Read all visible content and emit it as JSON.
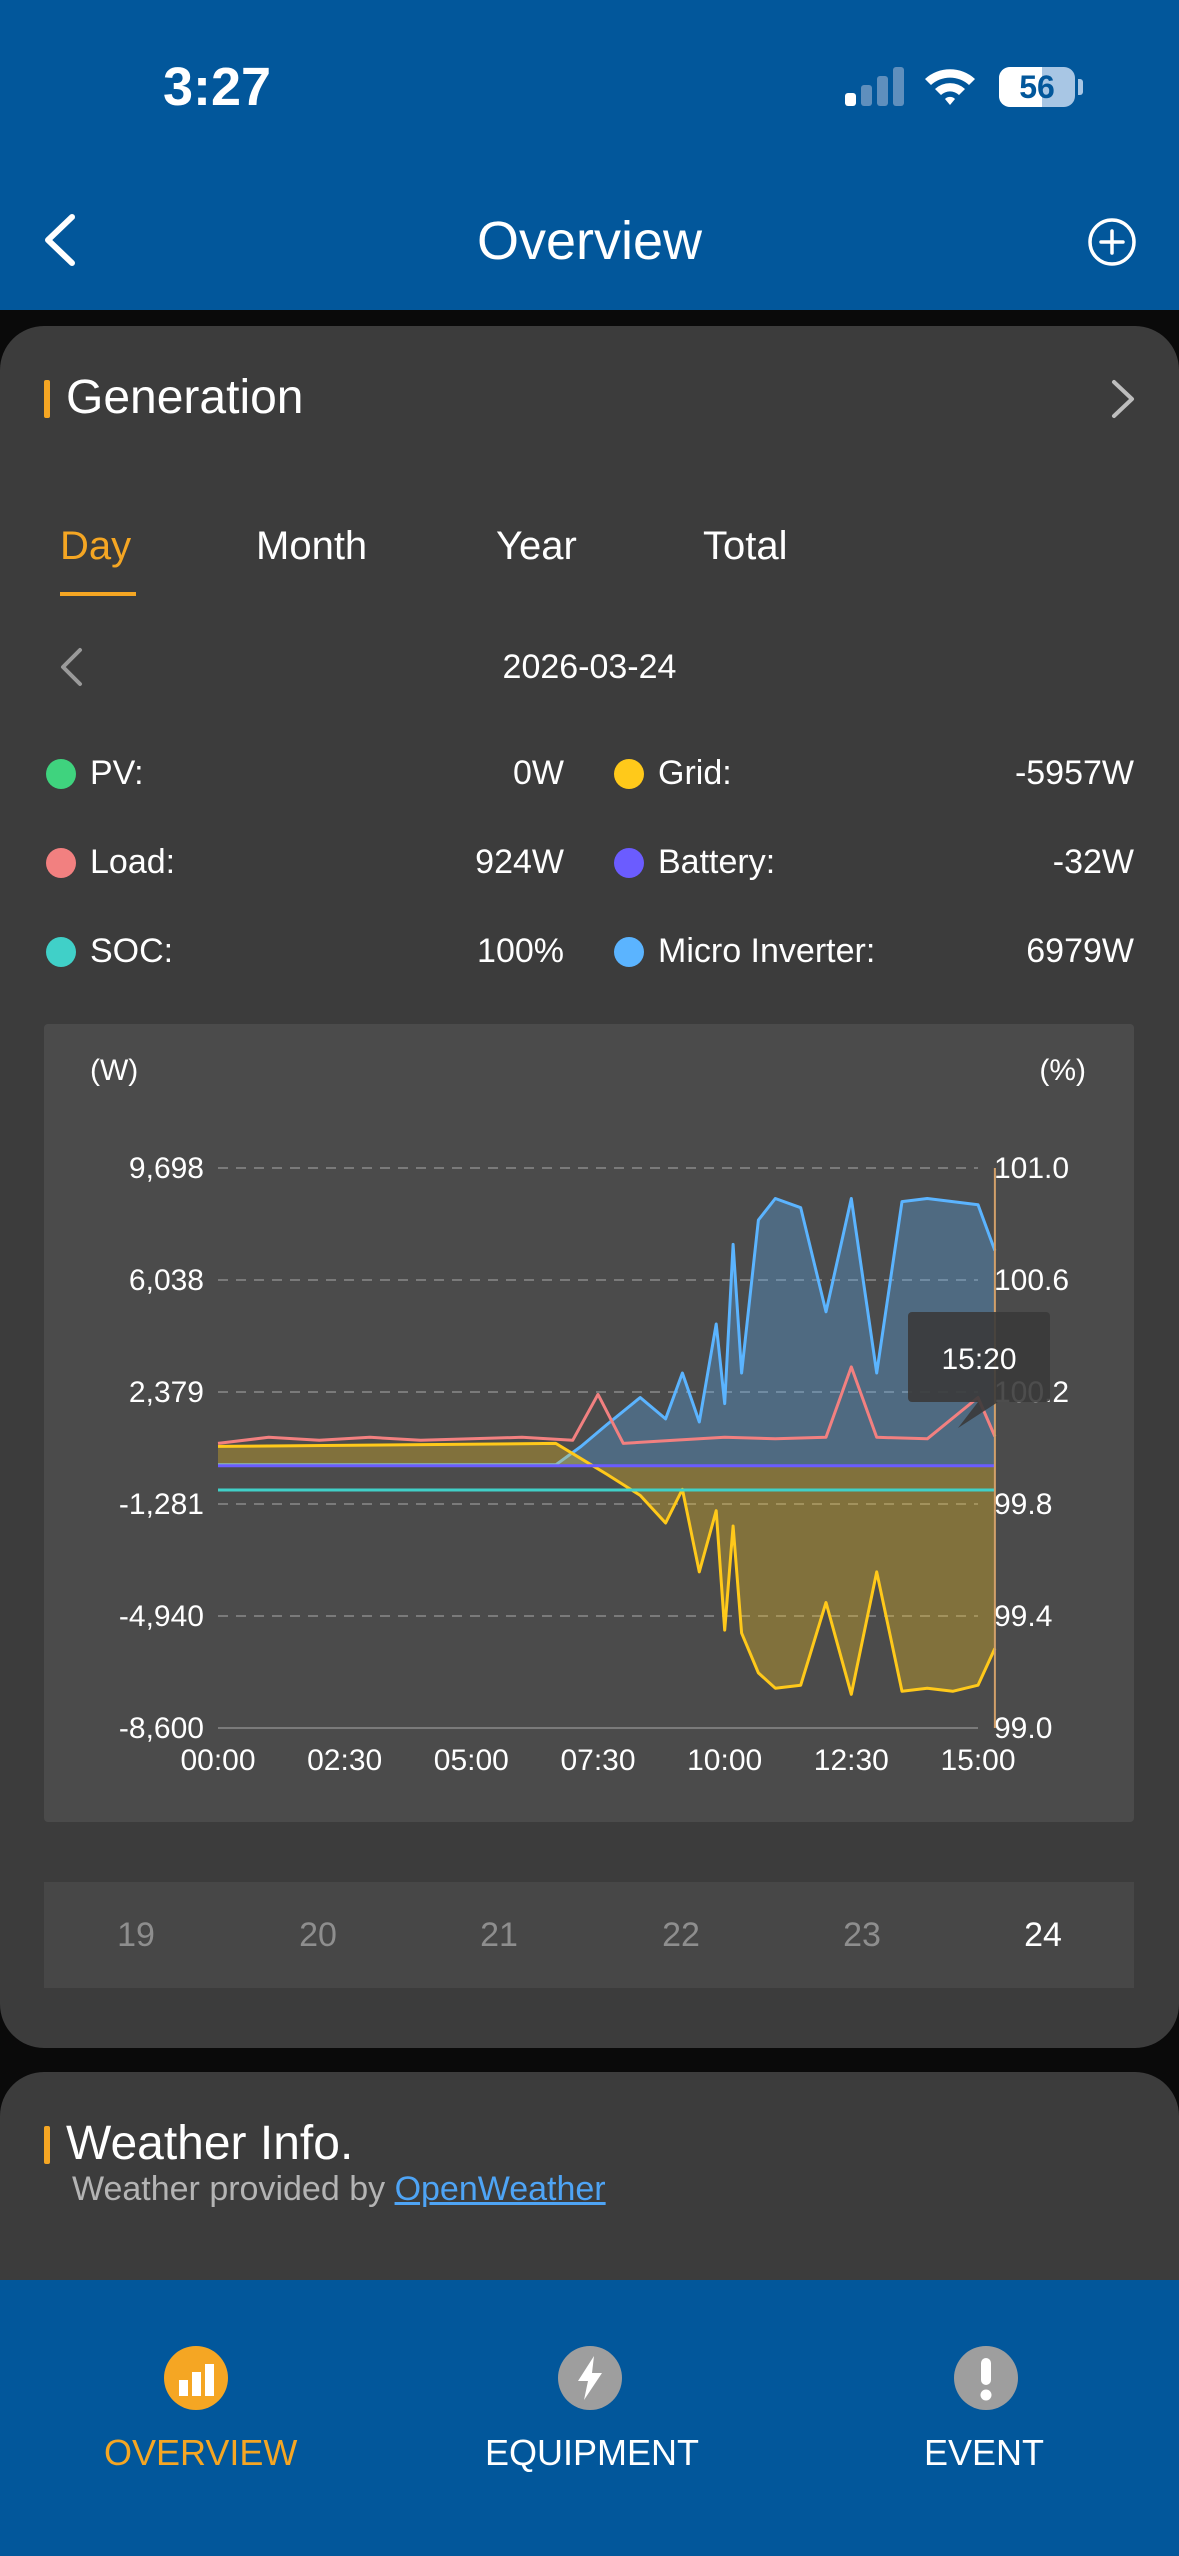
{
  "status_bar": {
    "time": "3:27",
    "battery_level": "56",
    "signal_bars_active": 1,
    "signal_bars_total": 4
  },
  "nav": {
    "title": "Overview"
  },
  "generation": {
    "title": "Generation",
    "tabs": [
      {
        "label": "Day",
        "active": true
      },
      {
        "label": "Month",
        "active": false
      },
      {
        "label": "Year",
        "active": false
      },
      {
        "label": "Total",
        "active": false
      }
    ],
    "date": "2026-03-24",
    "stats": [
      {
        "label": "PV:",
        "value": "0W",
        "color": "#3fd37e"
      },
      {
        "label": "Grid:",
        "value": "-5957W",
        "color": "#ffc91a"
      },
      {
        "label": "Load:",
        "value": "924W",
        "color": "#f28080"
      },
      {
        "label": "Battery:",
        "value": "-32W",
        "color": "#6b5cff"
      },
      {
        "label": "SOC:",
        "value": "100%",
        "color": "#40d0c8"
      },
      {
        "label": "Micro Inverter:",
        "value": "6979W",
        "color": "#5bb4ff"
      }
    ],
    "days": [
      {
        "label": "19",
        "active": false
      },
      {
        "label": "20",
        "active": false
      },
      {
        "label": "21",
        "active": false
      },
      {
        "label": "22",
        "active": false
      },
      {
        "label": "23",
        "active": false
      },
      {
        "label": "24",
        "active": true
      }
    ]
  },
  "chart_data": {
    "type": "area",
    "left_unit": "(W)",
    "right_unit": "(%)",
    "y_ticks": [
      "9,698",
      "6,038",
      "2,379",
      "-1,281",
      "-4,940",
      "-8,600"
    ],
    "y_ticks_right": [
      "101.0",
      "100.6",
      "100.2",
      "99.8",
      "99.4",
      "99.0"
    ],
    "ylim": [
      -8600,
      9698
    ],
    "ylim_right": [
      99.0,
      101.0
    ],
    "x_ticks": [
      "00:00",
      "02:30",
      "05:00",
      "07:30",
      "10:00",
      "12:30",
      "15:00"
    ],
    "tooltip": "15:20",
    "grid": true,
    "series": [
      {
        "name": "Micro Inverter",
        "color": "#5bb4ff",
        "x": [
          "00:00",
          "06:40",
          "07:10",
          "07:40",
          "08:20",
          "08:50",
          "09:10",
          "09:30",
          "09:50",
          "10:00",
          "10:10",
          "10:20",
          "10:40",
          "11:00",
          "11:30",
          "12:00",
          "12:30",
          "13:00",
          "13:30",
          "14:00",
          "14:30",
          "15:00",
          "15:20"
        ],
        "y": [
          0,
          0,
          600,
          1300,
          2200,
          1500,
          3000,
          1400,
          4600,
          2000,
          7200,
          3000,
          8000,
          8700,
          8400,
          5000,
          8700,
          3000,
          8600,
          8700,
          8600,
          8500,
          7000
        ]
      },
      {
        "name": "Grid",
        "color": "#ffc91a",
        "x": [
          "00:00",
          "06:40",
          "07:10",
          "07:40",
          "08:20",
          "08:50",
          "09:10",
          "09:30",
          "09:50",
          "10:00",
          "10:10",
          "10:20",
          "10:40",
          "11:00",
          "11:30",
          "12:00",
          "12:30",
          "13:00",
          "13:30",
          "14:00",
          "14:30",
          "15:00",
          "15:20"
        ],
        "y": [
          600,
          700,
          200,
          -300,
          -1000,
          -1900,
          -800,
          -3500,
          -1500,
          -5400,
          -2000,
          -5500,
          -6800,
          -7300,
          -7200,
          -4500,
          -7500,
          -3500,
          -7400,
          -7300,
          -7400,
          -7200,
          -6000
        ]
      },
      {
        "name": "Load",
        "color": "#f28080",
        "x": [
          "00:00",
          "01:00",
          "02:00",
          "03:00",
          "04:00",
          "05:00",
          "06:00",
          "07:00",
          "07:30",
          "08:00",
          "09:00",
          "10:00",
          "11:00",
          "12:00",
          "12:30",
          "13:00",
          "14:00",
          "15:00",
          "15:20"
        ],
        "y": [
          700,
          900,
          800,
          900,
          800,
          850,
          900,
          800,
          2300,
          700,
          800,
          900,
          850,
          900,
          3200,
          900,
          850,
          2200,
          924
        ]
      },
      {
        "name": "SOC",
        "color": "#40d0c8",
        "x": [
          "00:00",
          "15:20"
        ],
        "y": [
          99.85,
          99.85
        ],
        "axis": "right"
      },
      {
        "name": "Battery",
        "color": "#6b5cff",
        "x": [
          "00:00",
          "15:20"
        ],
        "y": [
          -32,
          -32
        ]
      }
    ]
  },
  "weather": {
    "title": "Weather Info.",
    "provided_by": "Weather provided by",
    "provider_link": "OpenWeather"
  },
  "tabbar": {
    "items": [
      {
        "label": "OVERVIEW",
        "active": true
      },
      {
        "label": "EQUIPMENT",
        "active": false
      },
      {
        "label": "EVENT",
        "active": false
      }
    ]
  },
  "colors": {
    "accent": "#f5a623",
    "brand_blue": "#02579b",
    "link": "#4ea4f5"
  }
}
